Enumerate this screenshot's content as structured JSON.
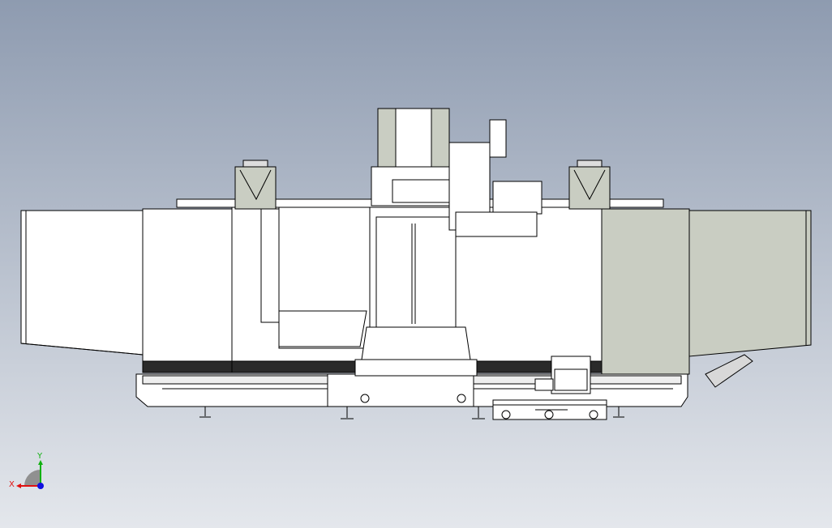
{
  "viewport": {
    "background_top": "#8e9bb0",
    "background_bottom": "#e4e7ec",
    "model_fill": "#ffffff",
    "model_shade": "#c9cdc2",
    "model_edge": "#000000",
    "dark_band": "#2a2a2a"
  },
  "triad": {
    "x_label": "X",
    "y_label": "Y",
    "x_color": "#e01010",
    "y_color": "#10b010",
    "z_color": "#1010e0",
    "icons": [
      "x-axis-arrow-icon",
      "y-axis-arrow-icon",
      "z-axis-dot-icon"
    ]
  }
}
